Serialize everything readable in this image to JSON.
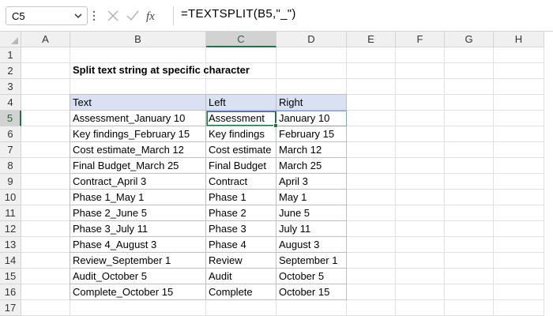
{
  "formula_bar": {
    "name_box": "C5",
    "formula": "=TEXTSPLIT(B5,\"_\")"
  },
  "icons": {
    "name_box_dropdown": "chevron-down-icon",
    "options": "vertical-dots-icon",
    "cancel": "x-cancel-icon",
    "enter": "check-enter-icon",
    "function": "fx-function-icon"
  },
  "columns": [
    "A",
    "B",
    "C",
    "D",
    "E",
    "F",
    "G",
    "H"
  ],
  "rows": [
    "1",
    "2",
    "3",
    "4",
    "5",
    "6",
    "7",
    "8",
    "9",
    "10",
    "11",
    "12",
    "13",
    "14",
    "15",
    "16",
    "17"
  ],
  "sheet": {
    "title": "Split text string at specific character",
    "headers": [
      "Text",
      "Left",
      "Right"
    ],
    "data": [
      [
        "Assessment_January 10",
        "Assessment",
        "January 10"
      ],
      [
        "Key findings_February 15",
        "Key findings",
        "February 15"
      ],
      [
        "Cost estimate_March 12",
        "Cost estimate",
        "March 12"
      ],
      [
        "Final Budget_March 25",
        "Final Budget",
        "March 25"
      ],
      [
        "Contract_April 3",
        "Contract",
        "April 3"
      ],
      [
        "Phase 1_May 1",
        "Phase 1",
        "May 1"
      ],
      [
        "Phase 2_June 5",
        "Phase 2",
        "June 5"
      ],
      [
        "Phase 3_July 11",
        "Phase 3",
        "July 11"
      ],
      [
        "Phase 4_August 3",
        "Phase 4",
        "August 3"
      ],
      [
        "Review_September 1",
        "Review",
        "September 1"
      ],
      [
        "Audit_October 5",
        "Audit",
        "October 5"
      ],
      [
        "Complete_October 15",
        "Complete",
        "October 15"
      ]
    ]
  },
  "colors": {
    "accent_green": "#217346",
    "header_fill": "#d9e1f2",
    "grid_line": "#e1e1e1"
  }
}
